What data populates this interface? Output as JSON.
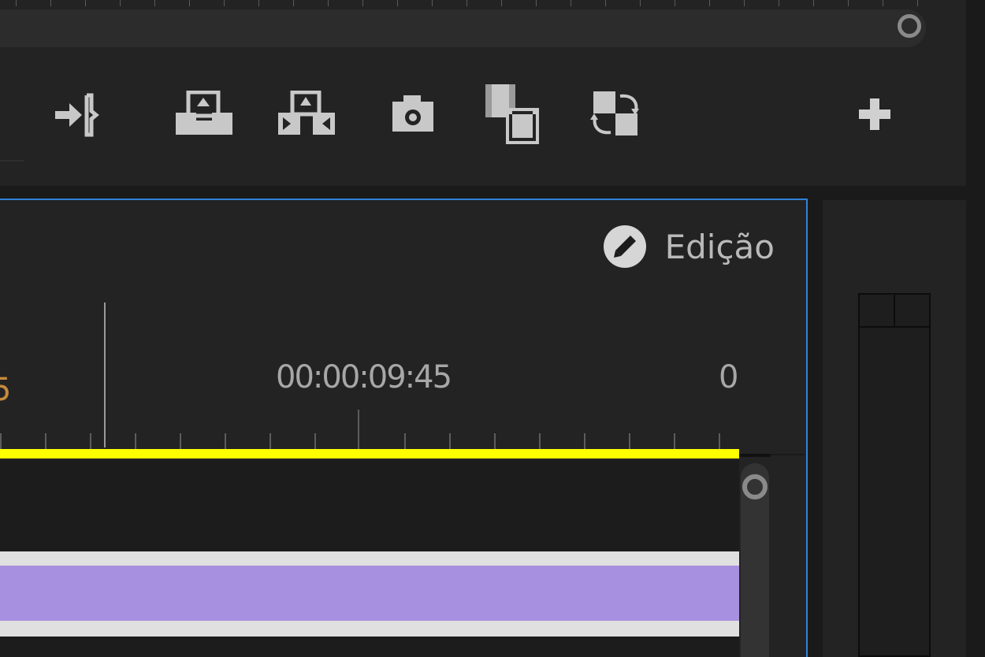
{
  "timeline": {
    "mode_label": "Edição",
    "timecode": "00:00:09:45",
    "end_label": "0"
  },
  "icons": {
    "insert": "go-to-out-point-icon",
    "lift": "lift-icon",
    "extract": "extract-icon",
    "export_frame": "camera-icon",
    "comparison": "comparison-view-icon",
    "toggle_proxies": "toggle-proxies-icon",
    "add_button": "plus-icon",
    "edit_mode": "pencil-icon"
  },
  "colors": {
    "accent_border": "#2f83d8",
    "work_area_bar": "#ffff00",
    "clip_audio": "#a890e0",
    "clip_rail": "#e0e0e0",
    "panel_bg": "#232323",
    "edge_label": "#c68a3b"
  }
}
